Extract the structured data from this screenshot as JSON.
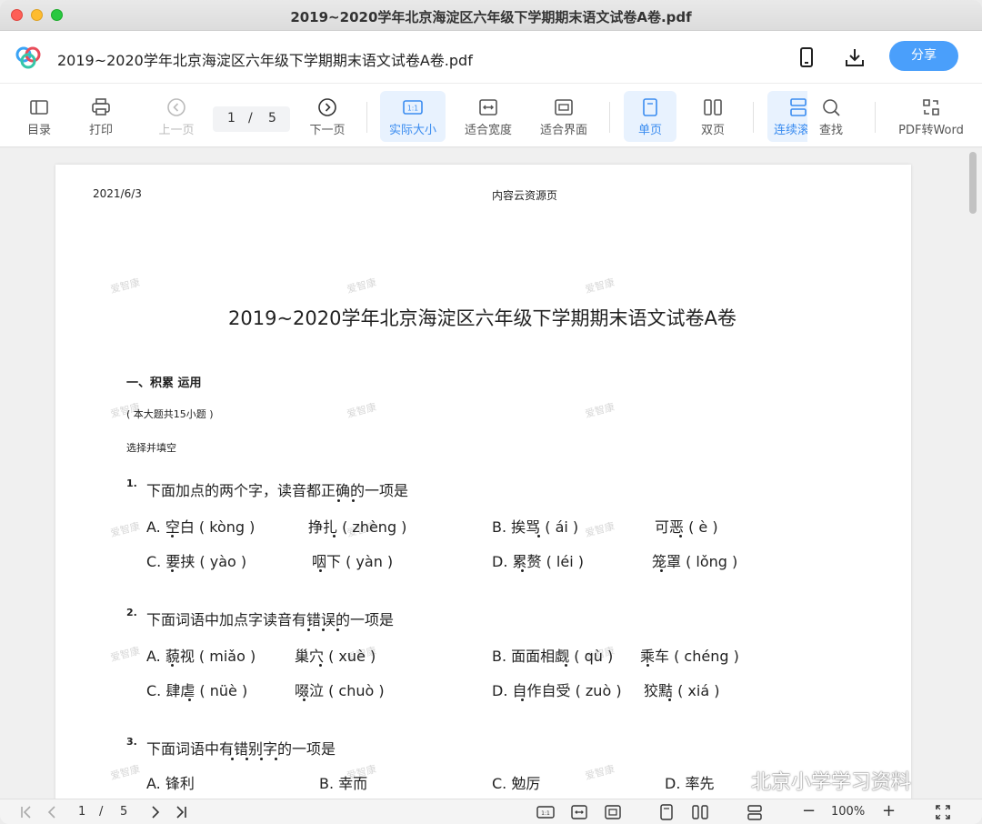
{
  "window": {
    "title": "2019~2020学年北京海淀区六年级下学期期末语文试卷A卷.pdf"
  },
  "header": {
    "doc_title": "2019~2020学年北京海淀区六年级下学期期末语文试卷A卷.pdf",
    "share_label": "分享"
  },
  "toolbar": {
    "toc": "目录",
    "print": "打印",
    "prev": "上一页",
    "page_current": "1",
    "page_sep": "/",
    "page_total": "5",
    "next": "下一页",
    "actual_size": "实际大小",
    "fit_width": "适合宽度",
    "fit_screen": "适合界面",
    "single": "单页",
    "double": "双页",
    "continuous": "连续滚",
    "find": "查找",
    "pdf_word": "PDF转Word",
    "actual_icon_text": "1:1"
  },
  "document": {
    "date": "2021/6/3",
    "source": "内容云资源页",
    "heading": "2019~2020学年北京海淀区六年级下学期期末语文试卷A卷",
    "section_title": "一、积累 运用",
    "section_note": "( 本大题共15小题 )",
    "instruction": "选择并填空",
    "watermark": "爱智康",
    "questions": [
      {
        "num": "1.",
        "text": "下面加点的两个字，读音都正确的一项是",
        "options": [
          "A. 空白 ( kòng )",
          "挣扎 ( zhèng )",
          "B. 挨骂 ( ái )",
          "可恶 ( è )",
          "C. 要挟 ( yào )",
          "咽下 ( yàn )",
          "D. 累赘 ( léi )",
          "笼罩 ( lǒng )"
        ]
      },
      {
        "num": "2.",
        "text": "下面词语中加点字读音有错误的一项是",
        "options": [
          "A. 藐视 ( miǎo )",
          "巢穴 ( xuè )",
          "B. 面面相觑 ( qù )",
          "乘车 ( chéng )",
          "C. 肆虐 ( nüè )",
          "啜泣 ( chuò )",
          "D. 自作自受 ( zuò )",
          "狡黠 ( xiá )"
        ]
      },
      {
        "num": "3.",
        "text": "下面词语中有错别字的一项是",
        "options": [
          "A. 锋利",
          "B. 幸而",
          "C. 勉厉",
          "D. 率先"
        ]
      }
    ]
  },
  "bottombar": {
    "page_current": "1",
    "page_sep": "/",
    "page_total": "5",
    "zoom": "100%",
    "zoom_out": "−",
    "zoom_in": "+",
    "actual_icon_text": "1:1"
  },
  "overlay": {
    "wechat_text": "北京小学学习资料"
  },
  "colors": {
    "accent": "#4a9ffb",
    "active_bg": "#e8f2fe",
    "active_text": "#3a8cf0"
  }
}
